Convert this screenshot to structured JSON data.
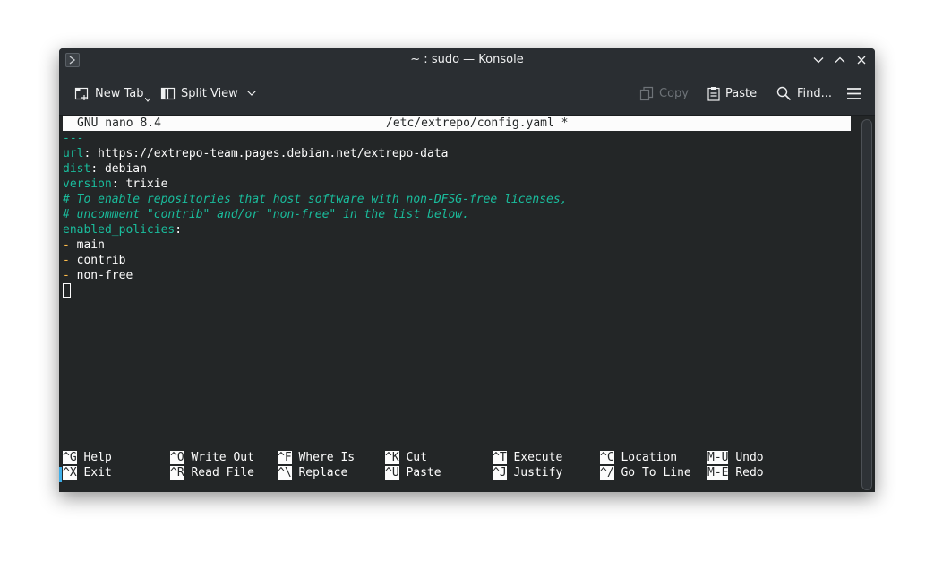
{
  "window": {
    "title": "~ : sudo — Konsole"
  },
  "toolbar": {
    "new_tab": "New Tab",
    "split_view": "Split View",
    "copy": "Copy",
    "paste": "Paste",
    "find": "Find..."
  },
  "nano": {
    "version": "GNU nano 8.4",
    "filename": "/etc/extrepo/config.yaml *"
  },
  "file": {
    "l1": "---",
    "l2_key": "url",
    "l2_val": ": https://extrepo-team.pages.debian.net/extrepo-data",
    "l3_key": "dist",
    "l3_val": ": debian",
    "l4_key": "version",
    "l4_val": ": trixie",
    "l5": "# To enable repositories that host software with non-DFSG-free licenses,",
    "l6": "# uncomment \"contrib\" and/or \"non-free\" in the list below.",
    "l7_key": "enabled_policies",
    "l7_val": ":",
    "item1": "main",
    "item2": "contrib",
    "item3": "non-free"
  },
  "shortcuts": {
    "row1": [
      {
        "key": "^G",
        "label": "Help"
      },
      {
        "key": "^O",
        "label": "Write Out"
      },
      {
        "key": "^F",
        "label": "Where Is"
      },
      {
        "key": "^K",
        "label": "Cut"
      },
      {
        "key": "^T",
        "label": "Execute"
      },
      {
        "key": "^C",
        "label": "Location"
      },
      {
        "key": "M-U",
        "label": "Undo"
      }
    ],
    "row2": [
      {
        "key": "^X",
        "label": "Exit"
      },
      {
        "key": "^R",
        "label": "Read File"
      },
      {
        "key": "^\\",
        "label": "Replace"
      },
      {
        "key": "^U",
        "label": "Paste"
      },
      {
        "key": "^J",
        "label": "Justify"
      },
      {
        "key": "^/",
        "label": "Go To Line"
      },
      {
        "key": "M-E",
        "label": "Redo"
      }
    ]
  },
  "icons": {
    "app": "konsole-icon",
    "minimize": "chevron-down-icon",
    "maximize": "chevron-up-icon",
    "close": "close-icon"
  },
  "colors": {
    "accent": "#1abc9c",
    "list_dash": "#fdbc4b",
    "background": "#232627"
  }
}
